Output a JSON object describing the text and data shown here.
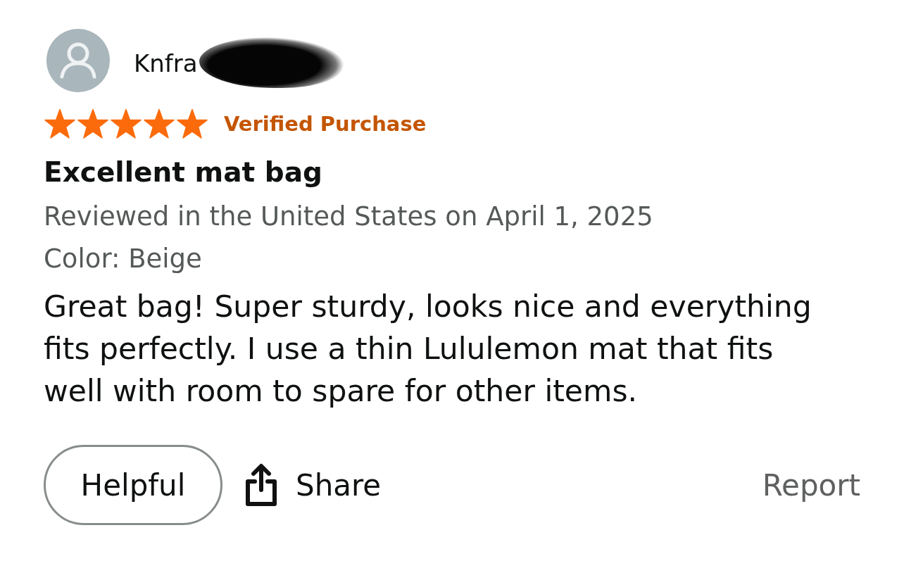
{
  "review": {
    "user": {
      "name": "Knfra",
      "name_redacted": true
    },
    "stars": 5,
    "verified_badge": "Verified Purchase",
    "title": "Excellent mat bag",
    "meta": "Reviewed in the United States on April 1, 2025",
    "variant": "Color: Beige",
    "body": "Great bag! Super sturdy, looks nice and everything fits perfectly. I use a thin Lululemon mat that fits well with room to spare for other items."
  },
  "actions": {
    "helpful": "Helpful",
    "share": "Share",
    "report": "Report"
  }
}
